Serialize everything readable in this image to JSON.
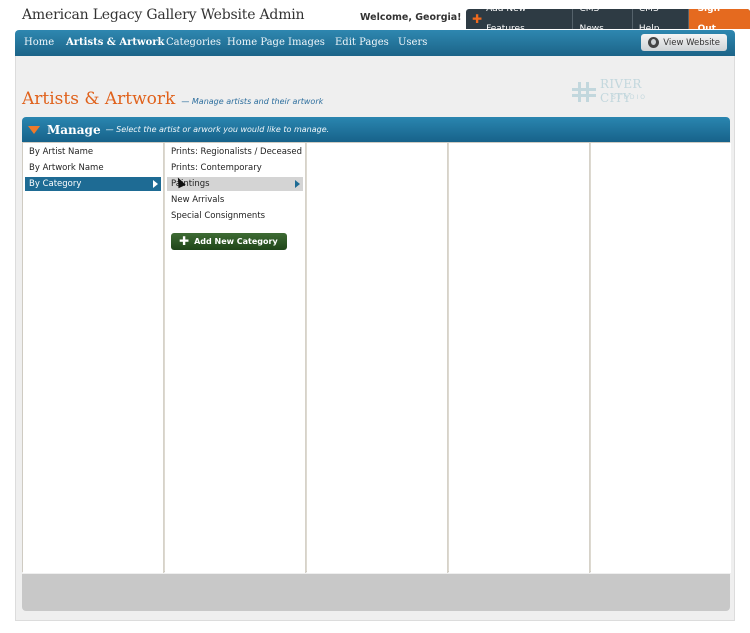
{
  "header": {
    "site_title": "American Legacy Gallery Website Admin",
    "welcome": "Welcome, Georgia!",
    "links": [
      {
        "label": "Add New Features",
        "icon": "plus-icon"
      },
      {
        "label": "CMS News"
      },
      {
        "label": "CMS Help"
      },
      {
        "label": "Sign Out"
      }
    ]
  },
  "nav": {
    "items": [
      {
        "label": "Home"
      },
      {
        "label": "Artists & Artwork",
        "active": true
      },
      {
        "label": "Categories"
      },
      {
        "label": "Home Page Images"
      },
      {
        "label": "Edit Pages"
      },
      {
        "label": "Users"
      }
    ],
    "view_website": "View Website"
  },
  "page": {
    "title": "Artists & Artwork",
    "subtitle": "— Manage artists and their artwork",
    "logo_text": "RIVER CITY",
    "logo_subtext": "STUDIO"
  },
  "manage": {
    "title": "Manage",
    "subtitle": "— Select the artist or arwork you would like to manage."
  },
  "columns": {
    "col1": [
      {
        "label": "By Artist Name"
      },
      {
        "label": "By Artwork Name"
      },
      {
        "label": "By Category",
        "selected": true
      }
    ],
    "col2": [
      {
        "label": "Prints: Regionalists / Deceased"
      },
      {
        "label": "Prints: Contemporary"
      },
      {
        "label": "Paintings",
        "hover": true
      },
      {
        "label": "New Arrivals"
      },
      {
        "label": "Special Consignments"
      }
    ],
    "add_category": "Add New Category"
  },
  "colors": {
    "nav_blue": "#1c6488",
    "accent_orange": "#e0621c",
    "signout_orange": "#e56a1f",
    "add_button_green": "#1f4519"
  }
}
